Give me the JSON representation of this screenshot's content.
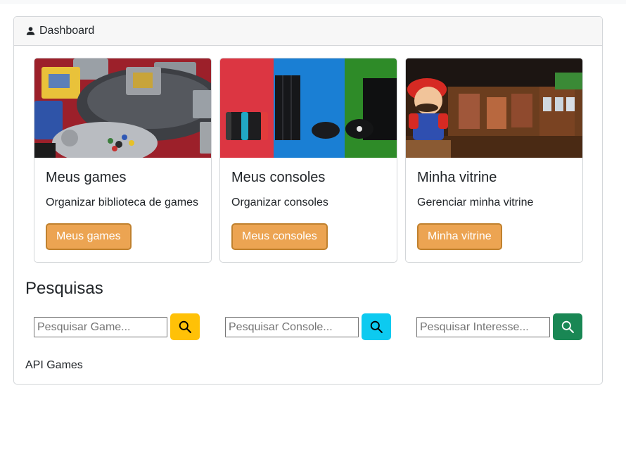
{
  "header": {
    "title": "Dashboard",
    "icon": "user-icon"
  },
  "cards": [
    {
      "title": "Meus games",
      "text": "Organizar biblioteca de games",
      "button": "Meus games",
      "image": "n64-games-photo"
    },
    {
      "title": "Meus consoles",
      "text": "Organizar consoles",
      "button": "Meus consoles",
      "image": "consoles-photo"
    },
    {
      "title": "Minha vitrine",
      "text": "Gerenciar minha vitrine",
      "button": "Minha vitrine",
      "image": "mario-showroom-photo"
    }
  ],
  "section": {
    "title": "Pesquisas"
  },
  "searches": [
    {
      "placeholder": "Pesquisar Game...",
      "button_color": "#ffc107",
      "icon": "search-icon"
    },
    {
      "placeholder": "Pesquisar Console...",
      "button_color": "#0dcaf0",
      "icon": "search-icon"
    },
    {
      "placeholder": "Pesquisar Interesse...",
      "button_color": "#198754",
      "icon": "search-icon"
    }
  ],
  "footer_text": "API Games",
  "colors": {
    "accent": "#eca452",
    "accent_border": "#c0812e"
  }
}
